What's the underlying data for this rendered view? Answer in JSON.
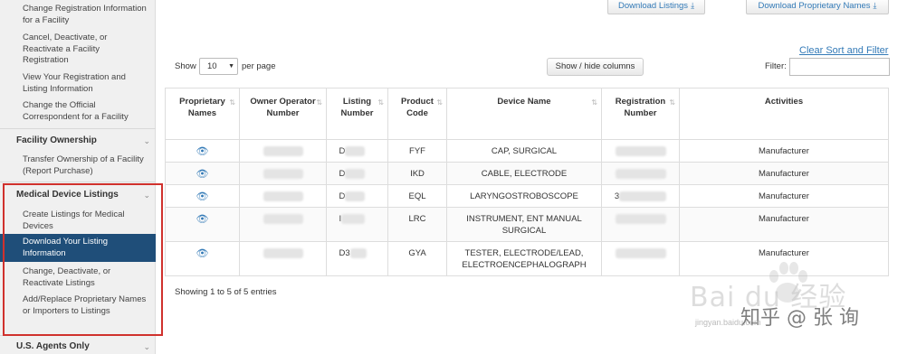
{
  "sidebar": {
    "items_top": [
      "Change Registration Information for a Facility",
      "Cancel, Deactivate, or Reactivate a Facility Registration",
      "View Your Registration and Listing Information",
      "Change the Official Correspondent for a Facility"
    ],
    "facility_ownership": {
      "title": "Facility Ownership",
      "items": [
        "Transfer Ownership of a Facility (Report Purchase)"
      ]
    },
    "medical_device_listings": {
      "title": "Medical Device Listings",
      "items": [
        "Create Listings for Medical Devices",
        "Download Your Listing Information",
        "Change, Deactivate, or Reactivate Listings",
        "Add/Replace Proprietary Names or Importers to Listings"
      ],
      "active_index": 1
    },
    "us_agents": {
      "title": "U.S. Agents Only"
    }
  },
  "toolbar": {
    "download_listings": "Download Listings",
    "download_proprietary": "Download Proprietary Names",
    "clear_sort_filter": "Clear Sort and Filter",
    "show_label": "Show",
    "show_value": "10",
    "per_page_label": "per page",
    "show_hide_columns": "Show / hide columns",
    "filter_label": "Filter:"
  },
  "table": {
    "headers": [
      "Proprietary Names",
      "Owner Operator Number",
      "Listing Number",
      "Product Code",
      "Device Name",
      "Registration Number",
      "Activities"
    ],
    "rows": [
      {
        "listing": "D",
        "code": "FYF",
        "device": "CAP, SURGICAL",
        "reg": "",
        "activity": "Manufacturer"
      },
      {
        "listing": "D",
        "code": "IKD",
        "device": "CABLE, ELECTRODE",
        "reg": "",
        "activity": "Manufacturer"
      },
      {
        "listing": "D",
        "code": "EQL",
        "device": "LARYNGOSTROBOSCOPE",
        "reg": "3",
        "activity": "Manufacturer"
      },
      {
        "listing": "I",
        "code": "LRC",
        "device": "INSTRUMENT, ENT MANUAL SURGICAL",
        "reg": "",
        "activity": "Manufacturer"
      },
      {
        "listing": "D3",
        "code": "GYA",
        "device": "TESTER, ELECTRODE/LEAD, ELECTROENCEPHALOGRAPH",
        "reg": "",
        "activity": "Manufacturer"
      }
    ]
  },
  "footer": {
    "entries": "Showing 1 to 5 of 5 entries"
  },
  "watermark": {
    "baidu": "Bai du 经验",
    "zhihu": "知乎 @ 张 询",
    "url": "jingyan.baidu.com"
  },
  "colors": {
    "accent": "#337ab7",
    "active": "#1f4e79",
    "highlight": "#d0312d"
  }
}
